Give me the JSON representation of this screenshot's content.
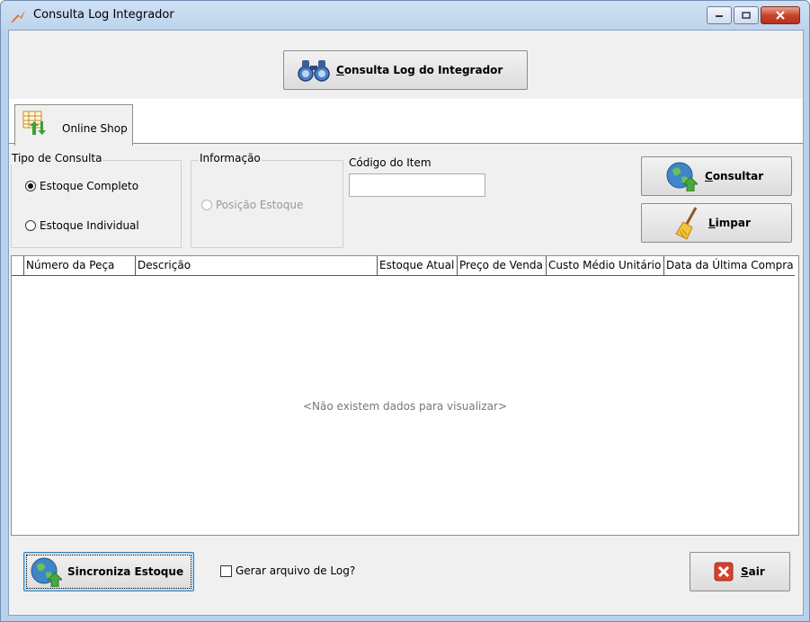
{
  "window": {
    "title": "Consulta Log Integrador"
  },
  "toolbar": {
    "consulta_log_label": "Consulta Log do Integrador",
    "consulta_log_mnemonic": "C",
    "consulta_log_rest": "onsulta Log do Integrador"
  },
  "tabs": [
    {
      "label": "Online Shop",
      "selected": true
    }
  ],
  "tipo_consulta": {
    "legend": "Tipo de Consulta",
    "options": [
      {
        "label": "Estoque Completo",
        "checked": true
      },
      {
        "label": "Estoque Individual",
        "checked": false
      }
    ]
  },
  "informacao": {
    "legend": "Informação",
    "options": [
      {
        "label": "Posição Estoque",
        "enabled": false
      }
    ]
  },
  "codigo_item": {
    "label": "Código do Item",
    "value": ""
  },
  "buttons": {
    "consultar": {
      "mnemonic": "C",
      "rest": "onsultar"
    },
    "limpar": {
      "mnemonic": "L",
      "rest": "impar"
    },
    "sincroniza": {
      "label": "Sincroniza Estoque"
    },
    "sair": {
      "mnemonic": "S",
      "rest": "air"
    }
  },
  "grid": {
    "columns": [
      "Número da Peça",
      "Descrição",
      "Estoque Atual",
      "Preço de Venda",
      "Custo Médio Unitário",
      "Data da Última Compra"
    ],
    "empty_text": "<Não existem dados para visualizar>"
  },
  "gerar_log": {
    "label": "Gerar arquivo de Log?",
    "checked": false
  },
  "colors": {
    "accent": "#3b6fb6",
    "close_red": "#c7452b"
  }
}
